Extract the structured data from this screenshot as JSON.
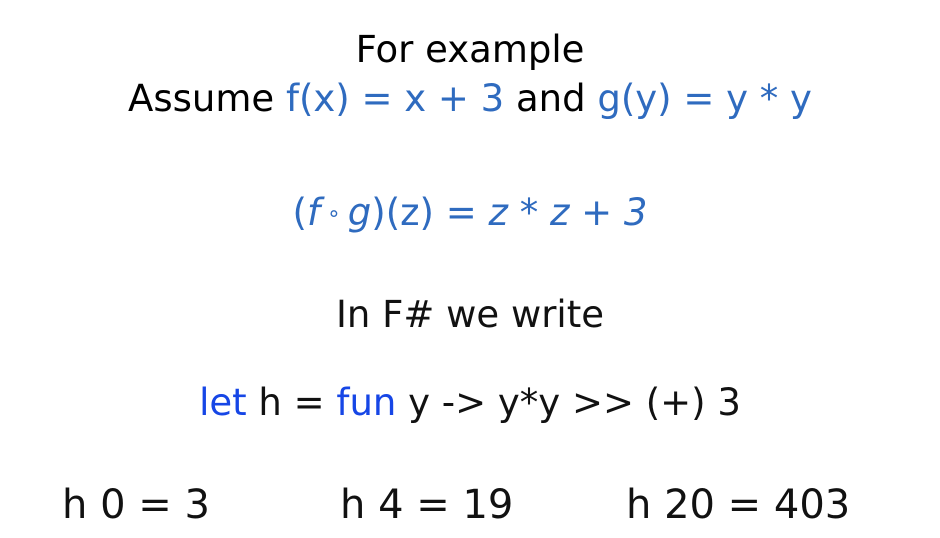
{
  "heading": "For example",
  "assume": {
    "prefix": "Assume ",
    "f_def": "f(x) = x + 3",
    "and": " and ",
    "g_def": "g(y) = y * y"
  },
  "composition": {
    "lhs_open": "(",
    "f": "f",
    "compose_op": " ∘ ",
    "g": "g",
    "lhs_close": ")(z)",
    "rhs": " = z * z + 3"
  },
  "fsharp_intro": "In F# we write",
  "code": {
    "kw_let": "let",
    "name": " h = ",
    "kw_fun": "fun",
    "body": " y -> y*y >> (+) 3"
  },
  "results": [
    "h 0 = 3",
    "h 4 = 19",
    "h 20 = 403"
  ],
  "colors": {
    "math_blue": "#2f6bbf",
    "keyword_blue": "#1646e6",
    "text": "#111111"
  }
}
